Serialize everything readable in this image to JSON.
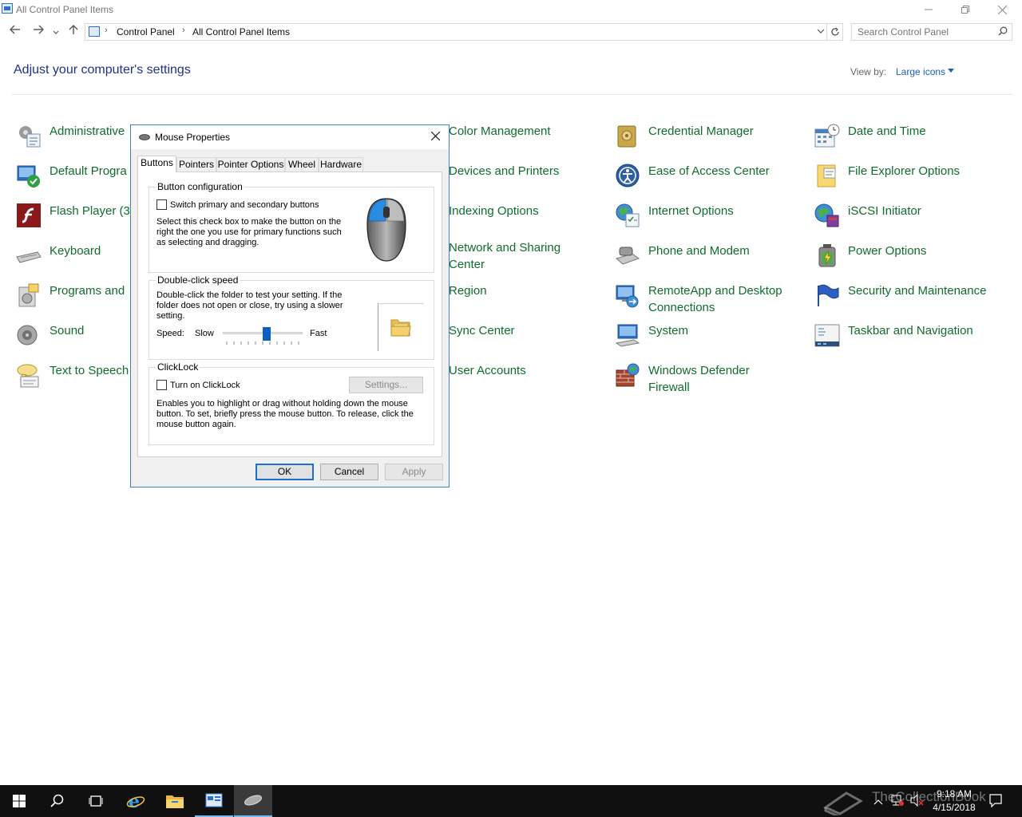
{
  "window": {
    "title": "All Control Panel Items"
  },
  "address": {
    "crumbs": [
      "Control Panel",
      "All Control Panel Items"
    ]
  },
  "search": {
    "placeholder": "Search Control Panel"
  },
  "header": {
    "title": "Adjust your computer's settings",
    "view_by_label": "View by:",
    "view_by_value": "Large icons"
  },
  "items": [
    {
      "label": "Administrative",
      "icon": "admin-tools-icon"
    },
    {
      "label": "Default Progra",
      "icon": "default-programs-icon"
    },
    {
      "label": "Flash Player (3",
      "icon": "flash-player-icon"
    },
    {
      "label": "Keyboard",
      "icon": "keyboard-icon"
    },
    {
      "label": "Programs and",
      "icon": "programs-icon"
    },
    {
      "label": "Sound",
      "icon": "sound-icon"
    },
    {
      "label": "Text to Speech",
      "icon": "speech-icon"
    },
    {
      "label": "Color Management",
      "icon": "color-management-icon"
    },
    {
      "label": "Devices and Printers",
      "icon": "devices-icon"
    },
    {
      "label": "Indexing Options",
      "icon": "indexing-icon"
    },
    {
      "label": "Network and Sharing\nCenter",
      "icon": "network-icon"
    },
    {
      "label": "Region",
      "icon": "region-icon"
    },
    {
      "label": "Sync Center",
      "icon": "sync-icon"
    },
    {
      "label": "User Accounts",
      "icon": "user-accounts-icon"
    },
    {
      "label": "Credential Manager",
      "icon": "credential-icon"
    },
    {
      "label": "Ease of Access Center",
      "icon": "ease-of-access-icon"
    },
    {
      "label": "Internet Options",
      "icon": "internet-options-icon"
    },
    {
      "label": "Phone and Modem",
      "icon": "phone-modem-icon"
    },
    {
      "label": "RemoteApp and Desktop\nConnections",
      "icon": "remoteapp-icon"
    },
    {
      "label": "System",
      "icon": "system-icon"
    },
    {
      "label": "Windows Defender\nFirewall",
      "icon": "firewall-icon"
    },
    {
      "label": "Date and Time",
      "icon": "date-time-icon"
    },
    {
      "label": "File Explorer Options",
      "icon": "file-explorer-icon"
    },
    {
      "label": "iSCSI Initiator",
      "icon": "iscsi-icon"
    },
    {
      "label": "Power Options",
      "icon": "power-icon"
    },
    {
      "label": "Security and Maintenance",
      "icon": "security-flag-icon"
    },
    {
      "label": "Taskbar and Navigation",
      "icon": "taskbar-icon"
    }
  ],
  "dialog": {
    "title": "Mouse Properties",
    "tabs": [
      "Buttons",
      "Pointers",
      "Pointer Options",
      "Wheel",
      "Hardware"
    ],
    "active_tab": "Buttons",
    "button_config": {
      "title": "Button configuration",
      "checkbox_label": "Switch primary and secondary buttons",
      "checked": false,
      "description": "Select this check box to make the button on the right the one you use for primary functions such as selecting and dragging."
    },
    "double_click": {
      "title": "Double-click speed",
      "description": "Double-click the folder to test your setting. If the folder does not open or close, try using a slower setting.",
      "speed_label": "Speed:",
      "slow_label": "Slow",
      "fast_label": "Fast",
      "slider_value": 0.55
    },
    "clicklock": {
      "title": "ClickLock",
      "checkbox_label": "Turn on ClickLock",
      "checked": false,
      "settings_label": "Settings...",
      "description": "Enables you to highlight or drag without holding down the mouse button. To set, briefly press the mouse button. To release, click the mouse button again."
    },
    "ok_label": "OK",
    "cancel_label": "Cancel",
    "apply_label": "Apply"
  },
  "taskbar": {
    "time": "9:18 AM",
    "date": "4/15/2018",
    "watermark": "TheCollectionBook"
  }
}
